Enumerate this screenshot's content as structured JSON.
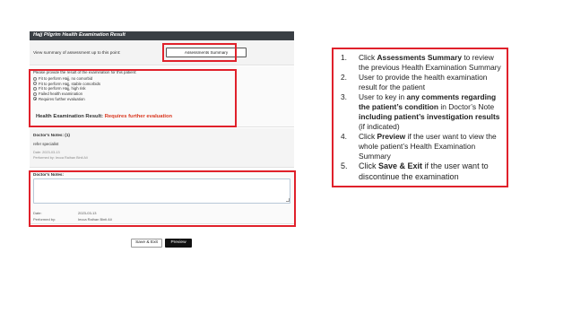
{
  "form": {
    "title": "Hajj Pilgrim Health Examination Result",
    "summary": {
      "label": "View summary of assessment up to this point:",
      "button": "Assessments Summary"
    },
    "result": {
      "prompt": "Please provide the result of the examination for this patient:",
      "options": [
        {
          "label": "Fit to perform Hajj, no comorbid",
          "selected": false
        },
        {
          "label": "Fit to perform Hajj, stable comorbids",
          "selected": false
        },
        {
          "label": "Fit to perform Hajj, high risk",
          "selected": false
        },
        {
          "label": "Failed health examination",
          "selected": false
        },
        {
          "label": "Requires further evaluation",
          "selected": true
        }
      ],
      "result_label": "Health Examination Result:",
      "result_value": "Requires further evaluation"
    },
    "notes": {
      "heading": "Doctor's Notes: (1)",
      "text": "refer specialist",
      "date": "Date: 2023-03-13",
      "performed_by": "Performed by: Iecca Raihan Binti Ali"
    },
    "note_input": {
      "heading": "Doctor's Notes:",
      "value": "",
      "date_label": "Date:",
      "date_value": "2023-03-13",
      "performed_label": "Performed by:",
      "performed_value": "Iecca Raihan Binti Ali"
    },
    "buttons": {
      "save_exit": "Save & Exit",
      "preview": "Preview"
    }
  },
  "instructions": [
    {
      "num": "1.",
      "parts": [
        {
          "t": "Click ",
          "b": false
        },
        {
          "t": "Assessments Summary",
          "b": true
        },
        {
          "t": " to review the previous Health Examination Summary",
          "b": false
        }
      ]
    },
    {
      "num": "2.",
      "parts": [
        {
          "t": "User to provide the health examination result for the patient",
          "b": false
        }
      ]
    },
    {
      "num": "3.",
      "parts": [
        {
          "t": "User to key in ",
          "b": false
        },
        {
          "t": "any comments regarding the patient’s condition",
          "b": true
        },
        {
          "t": " in Doctor’s Note ",
          "b": false
        },
        {
          "t": "including patient’s investigation results",
          "b": true
        },
        {
          "t": " (if indicated)",
          "b": false
        }
      ]
    },
    {
      "num": "4.",
      "parts": [
        {
          "t": "Click ",
          "b": false
        },
        {
          "t": "Preview",
          "b": true
        },
        {
          "t": " if the user want to view the whole patient’s Health Examination Summary",
          "b": false
        }
      ]
    },
    {
      "num": "5.",
      "parts": [
        {
          "t": "Click ",
          "b": false
        },
        {
          "t": "Save & Exit",
          "b": true
        },
        {
          "t": " if the user want to discontinue the examination",
          "b": false
        }
      ]
    }
  ],
  "colors": {
    "highlight": "#e0212b",
    "title_bar": "#3a3f44",
    "result_value": "#d9361e"
  }
}
